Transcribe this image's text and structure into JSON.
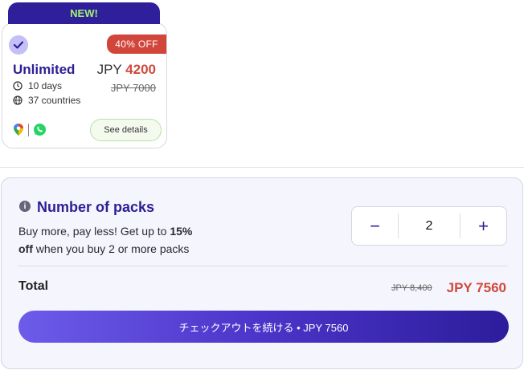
{
  "card": {
    "badge": "NEW!",
    "discount": "40% OFF",
    "name": "Unlimited",
    "currency": "JPY",
    "price": "4200",
    "old_price": "JPY 7000",
    "duration": "10 days",
    "coverage": "37 countries",
    "details_label": "See details"
  },
  "packs": {
    "title": "Number of packs",
    "desc_1": "Buy more, pay less! Get up to ",
    "desc_bold_1": "15%",
    "desc_bold_2": "off",
    "desc_2": " when you buy 2 or more packs",
    "minus": "−",
    "quantity": "2",
    "plus": "+",
    "total_label": "Total",
    "total_old": "JPY 8,400",
    "total_new": "JPY 7560",
    "checkout_label": "チェックアウトを続ける • JPY 7560"
  },
  "colors": {
    "brand": "#2c1f95",
    "accent_green": "#a4f46e",
    "sale_red": "#cf4a3c"
  }
}
